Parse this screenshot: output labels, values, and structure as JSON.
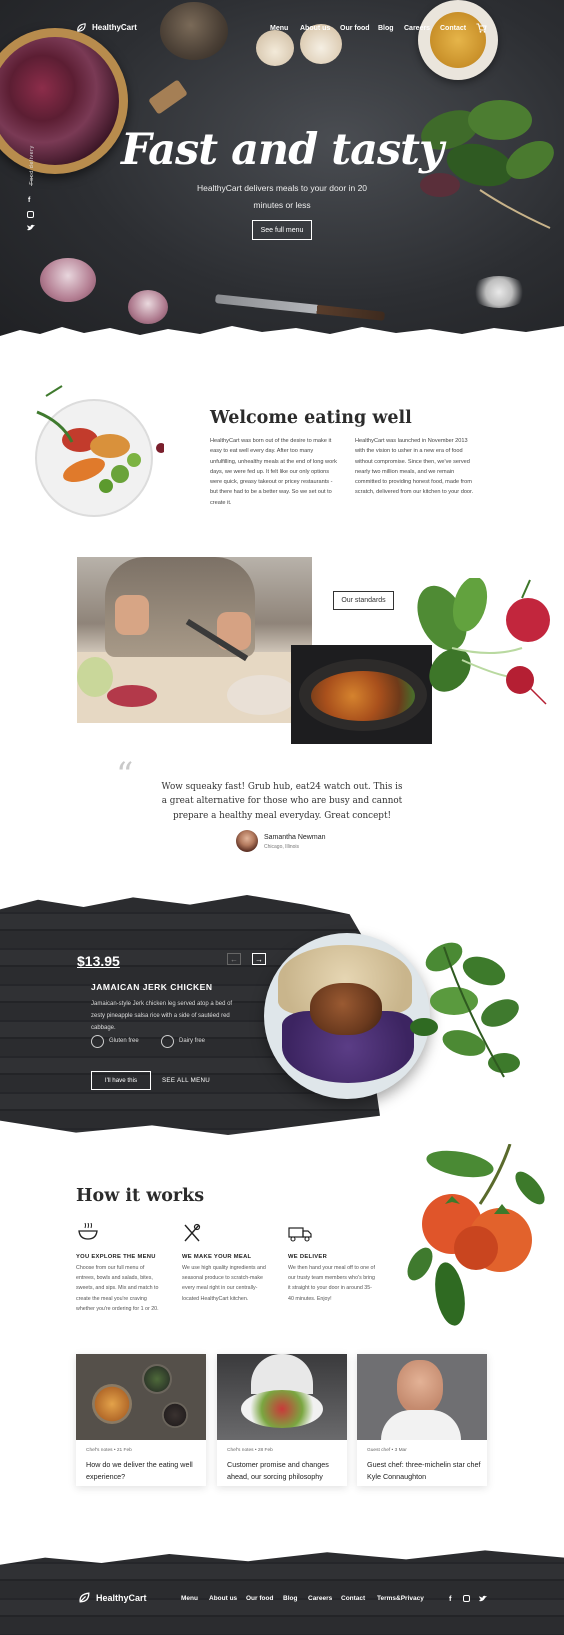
{
  "brand": {
    "name": "HealthyCart"
  },
  "nav": {
    "items": [
      "Menu",
      "About us",
      "Our food",
      "Blog",
      "Careers",
      "Contact"
    ]
  },
  "hero": {
    "title": "Fast and tasty",
    "subtitle": "HealthyCart delivers meals to your door in 20 minutes or less",
    "cta": "See full menu",
    "side_label": "Food delivery",
    "social": [
      "facebook-icon",
      "instagram-icon",
      "twitter-icon"
    ]
  },
  "welcome": {
    "title": "Welcome eating well",
    "col1": "HealthyCart was born out of the desire to make it easy to eat well every day. After too many unfulfilling, unhealthy meals at the end of long work days, we were fed up. It felt like our only options were quick, greasy takeout or pricey restaurants - but there had to be a better way. So we set out to create it.",
    "col2": "HealthyCart was launched in November 2013 with the vision to usher in a new era of food without compromise. Since then, we've served nearly two million meals, and we remain committed to providing honest food, made from scratch, delivered from our kitchen to your door.",
    "standards_btn": "Our standards"
  },
  "testimonial": {
    "quote": "Wow squeaky fast! Grub hub, eat24 watch out. This is a great alternative for those who are busy and cannot prepare a healthy meal everyday. Great concept!",
    "name": "Samantha Newman",
    "location": "Chicago, Illinois"
  },
  "meal": {
    "price": "$13.95",
    "name": "JAMAICAN JERK CHICKEN",
    "description": "Jamaican-style Jerk chicken leg served atop a bed of zesty pineapple salsa rice with a side of sautéed red cabbage.",
    "tags": [
      "Gluten free",
      "Dairy free"
    ],
    "cta": "I'll have this",
    "link": "SEE ALL MENU"
  },
  "how": {
    "title": "How it works",
    "steps": [
      {
        "icon": "bowl-icon",
        "title": "YOU EXPLORE THE MENU",
        "text": "Choose from our full menu of entrees, bowls and salads, bites, sweets, and sips. Mix and match to create the meal you're craving whether you're ordering for 1 or 20."
      },
      {
        "icon": "utensils-icon",
        "title": "WE MAKE YOUR MEAL",
        "text": "We use high quality ingredients and seasonal produce to scratch-make every meal right in our centrally-located HealthyCart kitchen."
      },
      {
        "icon": "truck-icon",
        "title": "WE DELIVER",
        "text": "We then hand your meal off to one of our trusty team members who's bring it straight to your door in around 35-40 minutes. Enjoy!"
      }
    ]
  },
  "blog": {
    "cards": [
      {
        "category": "Chef's notes",
        "date": "21 Feb",
        "title": "How do we deliver the eating well experience?"
      },
      {
        "category": "Chef's notes",
        "date": "28 Feb",
        "title": "Customer promise and changes ahead, our sorcing philosophy"
      },
      {
        "category": "Guest chef",
        "date": "3 Mar",
        "title": "Guest chef: three-michelin star chef Kyle Connaughton"
      }
    ]
  },
  "footer": {
    "items": [
      "Menu",
      "About us",
      "Our food",
      "Blog",
      "Careers",
      "Contact",
      "Terms&Privacy"
    ],
    "social": [
      "facebook-icon",
      "instagram-icon",
      "twitter-icon"
    ]
  },
  "colors": {
    "dark": "#2b2c2f",
    "text": "#2b2b2b",
    "tomato": "#e0552a",
    "leaf": "#3f7a2e"
  }
}
